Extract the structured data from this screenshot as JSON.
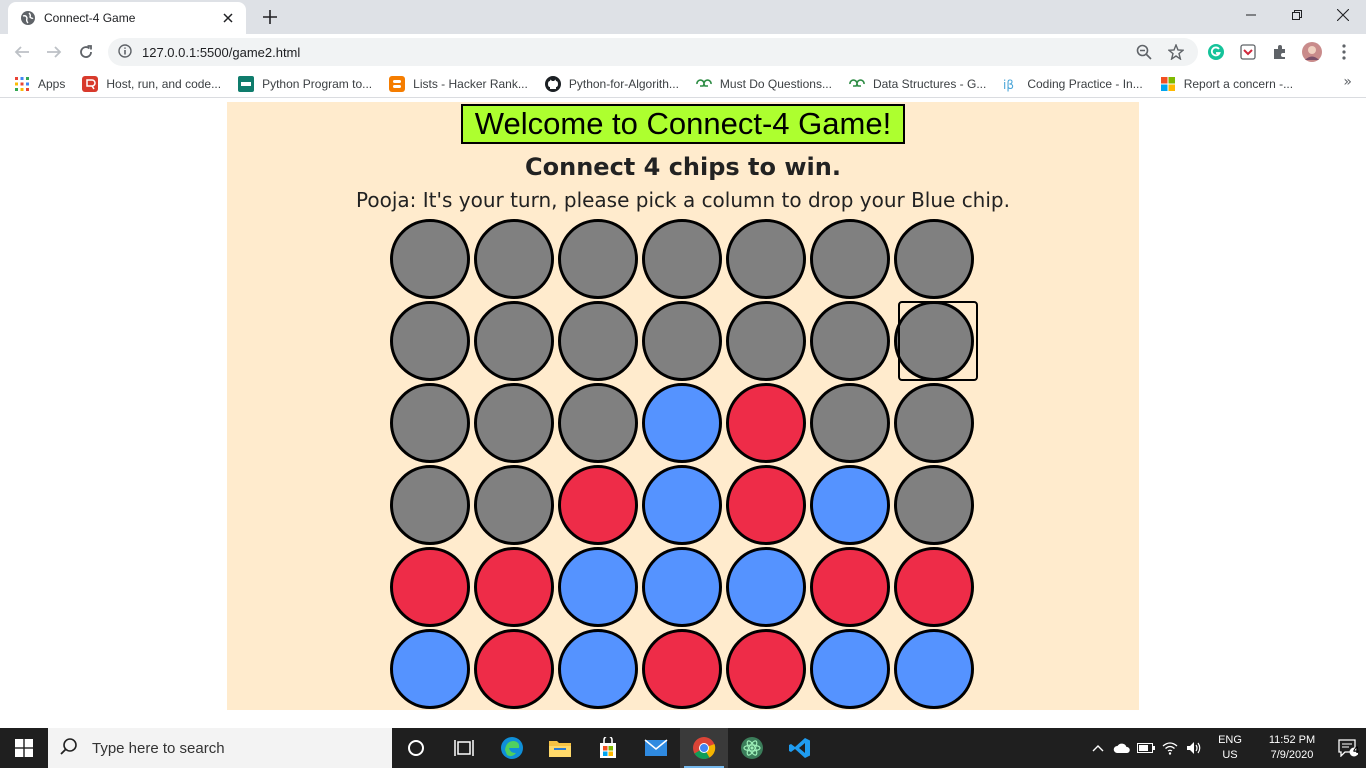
{
  "browser": {
    "tab_title": "Connect-4 Game",
    "url": "127.0.0.1:5500/game2.html"
  },
  "bookmarks": [
    {
      "label": "Apps",
      "icon": "apps-grid-icon"
    },
    {
      "label": "Host, run, and code...",
      "icon": "replit-icon"
    },
    {
      "label": "Python Program to...",
      "icon": "site-icon"
    },
    {
      "label": "Lists - Hacker Rank...",
      "icon": "blogger-icon"
    },
    {
      "label": "Python-for-Algorith...",
      "icon": "github-icon"
    },
    {
      "label": "Must Do Questions...",
      "icon": "gfg-icon"
    },
    {
      "label": "Data Structures - G...",
      "icon": "gfg-icon"
    },
    {
      "label": "Coding Practice - In...",
      "icon": "ib-icon"
    },
    {
      "label": "Report a concern -...",
      "icon": "microsoft-icon"
    }
  ],
  "game": {
    "title": "Welcome to Connect-4 Game!",
    "subtitle": "Connect 4 chips to win.",
    "turn_message": "Pooja: It's your turn, please pick a column to drop your Blue chip.",
    "colors": {
      "empty": "#808080",
      "blue": "#5593ff",
      "red": "#ee2c48",
      "panel": "#ffebcd",
      "title_bg": "#adff2f"
    },
    "hover_cell": {
      "row": 1,
      "col": 6
    },
    "board": [
      [
        "empty",
        "empty",
        "empty",
        "empty",
        "empty",
        "empty",
        "empty"
      ],
      [
        "empty",
        "empty",
        "empty",
        "empty",
        "empty",
        "empty",
        "empty"
      ],
      [
        "empty",
        "empty",
        "empty",
        "blue",
        "red",
        "empty",
        "empty"
      ],
      [
        "empty",
        "empty",
        "red",
        "blue",
        "red",
        "blue",
        "empty"
      ],
      [
        "red",
        "red",
        "blue",
        "blue",
        "blue",
        "red",
        "red"
      ],
      [
        "blue",
        "red",
        "blue",
        "red",
        "red",
        "blue",
        "blue"
      ]
    ]
  },
  "taskbar": {
    "search_placeholder": "Type here to search",
    "lang_line1": "ENG",
    "lang_line2": "US",
    "time": "11:52 PM",
    "date": "7/9/2020",
    "notification_count": "4"
  }
}
